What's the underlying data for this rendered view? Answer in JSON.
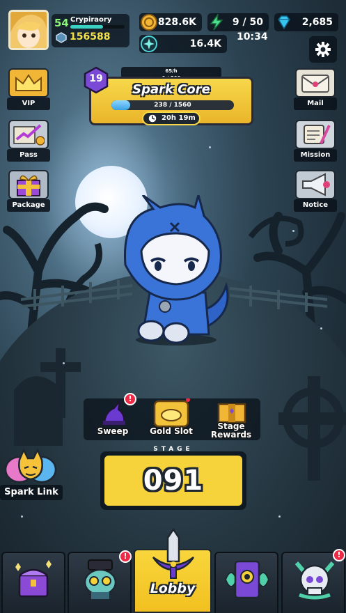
{
  "player": {
    "level": "54",
    "name": "Crypiraory",
    "power": "156588"
  },
  "resources": {
    "gold": "828.6K",
    "energy": "9 / 50",
    "energy_timer": "10:34",
    "gems": "2,685",
    "spark": "16.4K"
  },
  "side_left": [
    {
      "label": "VIP"
    },
    {
      "label": "Pass"
    },
    {
      "label": "Package"
    }
  ],
  "side_right": [
    {
      "label": "Mail"
    },
    {
      "label": "Mission"
    },
    {
      "label": "Notice"
    }
  ],
  "event": {
    "level": "19",
    "top_line1": "65/h",
    "top_line2": "0 / 500",
    "title": "Spark Core",
    "progress_text": "238 / 1560",
    "progress": 0.153,
    "timer": "20h 19m"
  },
  "actions": [
    {
      "label": "Sweep",
      "badge": "!"
    },
    {
      "label": "Gold Slot"
    },
    {
      "label": "Stage Rewards"
    }
  ],
  "stage": {
    "label": "STAGE",
    "number": "091"
  },
  "spark_link": {
    "label": "Spark Link"
  },
  "nav": {
    "tabs": [
      {
        "label": "",
        "icon": "shop-chest-icon"
      },
      {
        "label": "",
        "icon": "robot-hero-icon",
        "badge": "!"
      },
      {
        "label": "Lobby",
        "icon": "sword-icon",
        "active": true
      },
      {
        "label": "",
        "icon": "portal-card-icon"
      },
      {
        "label": "",
        "icon": "skull-icon",
        "badge": "!"
      }
    ]
  },
  "colors": {
    "accent_yellow": "#f6d33a",
    "panel_dark": "#0a121a",
    "alert_red": "#ee2a46",
    "level_green": "#8cf27a",
    "power_yellow": "#f5e24a"
  }
}
